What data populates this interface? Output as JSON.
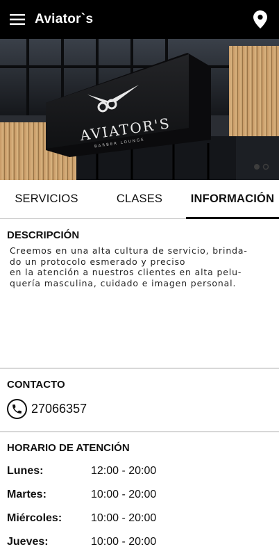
{
  "appbar": {
    "title": "Aviator`s",
    "menu_icon": "hamburger-menu-icon",
    "location_icon": "location-pin-icon"
  },
  "hero": {
    "sign_name": "AVIATOR'S",
    "sign_tagline": "BARBER LOUNGE",
    "slide_count": 2,
    "active_slide": 1
  },
  "tabs": [
    {
      "label": "SERVICIOS",
      "active": false
    },
    {
      "label": "CLASES",
      "active": false
    },
    {
      "label": "INFORMACIÓN",
      "active": true
    }
  ],
  "description": {
    "title": "DESCRIPCIÓN",
    "text": "Creemos en una alta cultura de servicio, brinda-\ndo un protocolo esmerado y preciso\nen la atención a nuestros clientes en alta pelu-\nquería masculina, cuidado e imagen personal."
  },
  "contact": {
    "title": "CONTACTO",
    "phone_icon": "phone-icon",
    "phone": "27066357"
  },
  "hours": {
    "title": "HORARIO DE ATENCIÓN",
    "rows": [
      {
        "day": "Lunes:",
        "time": "12:00 - 20:00"
      },
      {
        "day": "Martes:",
        "time": "10:00 - 20:00"
      },
      {
        "day": "Miércoles:",
        "time": "10:00 - 20:00"
      },
      {
        "day": "Jueves:",
        "time": "10:00 - 20:00"
      }
    ]
  },
  "colors": {
    "appbar": "#000000",
    "accent": "#000000",
    "divider": "#d8d8d8"
  }
}
